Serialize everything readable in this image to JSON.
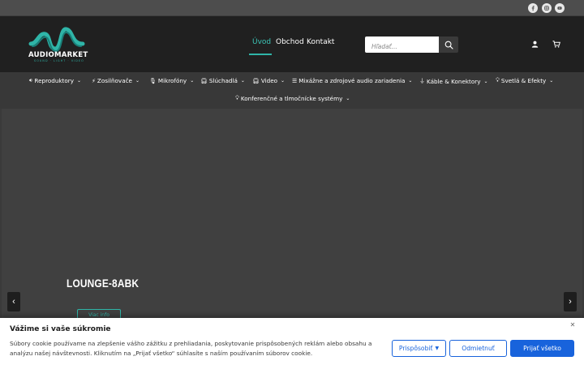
{
  "colors": {
    "accent": "#2fb5a8",
    "header_bg": "#202020",
    "topbar_bg": "#4d4d4d",
    "nav_bg": "#383838",
    "hero_bg": "#404040",
    "cookie_primary": "#1863dc"
  },
  "topbar": {
    "social_icons": [
      "facebook-icon",
      "instagram-icon",
      "youtube-icon"
    ]
  },
  "brand": {
    "name": "AUDIOMARKET",
    "tagline": "SOUND · LIGHT · VIDEO"
  },
  "main_nav": {
    "items": [
      {
        "label": "Úvod",
        "active": true
      },
      {
        "label": "Obchod",
        "active": false
      },
      {
        "label": "Kontakt",
        "active": false
      }
    ]
  },
  "search": {
    "placeholder": "Hľadať..."
  },
  "header_icons": [
    "user-icon",
    "cart-icon"
  ],
  "categories": [
    {
      "label": "Reproduktory",
      "icon": "speaker-icon"
    },
    {
      "label": "Zosilňovače",
      "icon": "bolt-icon"
    },
    {
      "label": "Mikrofóny",
      "icon": "microphone-icon"
    },
    {
      "label": "Slúchadlá",
      "icon": "headphones-icon"
    },
    {
      "label": "Video",
      "icon": "headset-icon"
    },
    {
      "label": "Mixážne a zdrojové audio zariadenia",
      "icon": "sliders-icon"
    },
    {
      "label": "Káble & Konektory",
      "icon": "plug-icon"
    },
    {
      "label": "Svetlá & Efekty",
      "icon": "bulb-icon"
    },
    {
      "label": "Konferenčné a tlmočnícke systémy",
      "icon": "bulb-icon"
    }
  ],
  "hero": {
    "title": "LOUNGE-8ABK",
    "button_label": "Viac info"
  },
  "cookie": {
    "title": "Vážime si vaše súkromie",
    "text": "Súbory cookie používame na zlepšenie vášho zážitku z prehliadania, poskytovanie prispôsobených reklám alebo obsahu a analýzu našej návštevnosti. Kliknutím na „Prijať všetko“ súhlasíte s naším používaním súborov cookie.",
    "customize_label": "Prispôsobiť",
    "reject_label": "Odmietnuť",
    "accept_label": "Prijať všetko"
  }
}
